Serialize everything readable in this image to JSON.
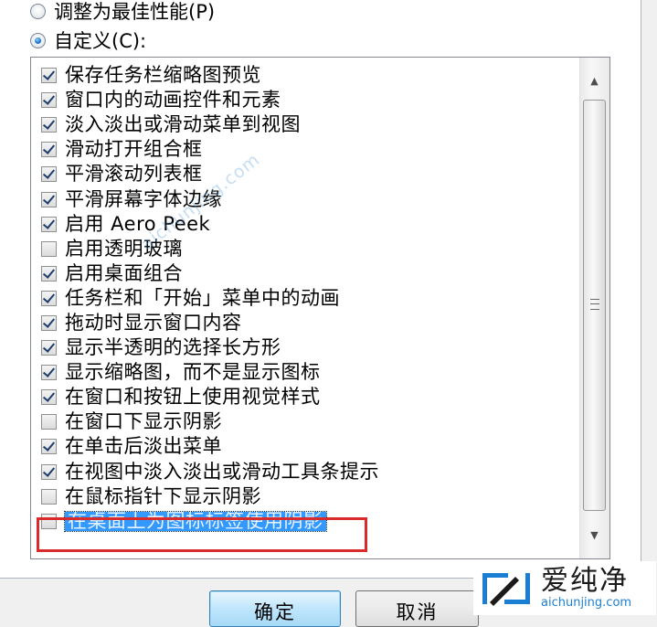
{
  "radios": [
    {
      "label": "调整为最佳性能(P)",
      "checked": false
    },
    {
      "label": "自定义(C):",
      "checked": true
    }
  ],
  "items": [
    {
      "label": "保存任务栏缩略图预览",
      "checked": true
    },
    {
      "label": "窗口内的动画控件和元素",
      "checked": true
    },
    {
      "label": "淡入淡出或滑动菜单到视图",
      "checked": true
    },
    {
      "label": "滑动打开组合框",
      "checked": true
    },
    {
      "label": "平滑滚动列表框",
      "checked": true
    },
    {
      "label": "平滑屏幕字体边缘",
      "checked": true
    },
    {
      "label": "启用 Aero Peek",
      "checked": true
    },
    {
      "label": "启用透明玻璃",
      "checked": false
    },
    {
      "label": "启用桌面组合",
      "checked": true
    },
    {
      "label": "任务栏和「开始」菜单中的动画",
      "checked": true
    },
    {
      "label": "拖动时显示窗口内容",
      "checked": true
    },
    {
      "label": "显示半透明的选择长方形",
      "checked": true
    },
    {
      "label": "显示缩略图，而不是显示图标",
      "checked": true
    },
    {
      "label": "在窗口和按钮上使用视觉样式",
      "checked": true
    },
    {
      "label": "在窗口下显示阴影",
      "checked": false
    },
    {
      "label": "在单击后淡出菜单",
      "checked": true
    },
    {
      "label": "在视图中淡入淡出或滑动工具条提示",
      "checked": true
    },
    {
      "label": "在鼠标指针下显示阴影",
      "checked": false
    },
    {
      "label": "在桌面上为图标标签使用阴影",
      "checked": false,
      "selected": true
    }
  ],
  "buttons": {
    "ok": "确定",
    "cancel": "取消"
  },
  "watermark": {
    "diagonal": "aichunjing.com",
    "logo_cn": "爱纯净",
    "logo_url": "aichunjing.com"
  },
  "colors": {
    "selection": "#3399ff",
    "highlight_box": "#d92b2b",
    "logo_blue": "#1a7fd3"
  }
}
